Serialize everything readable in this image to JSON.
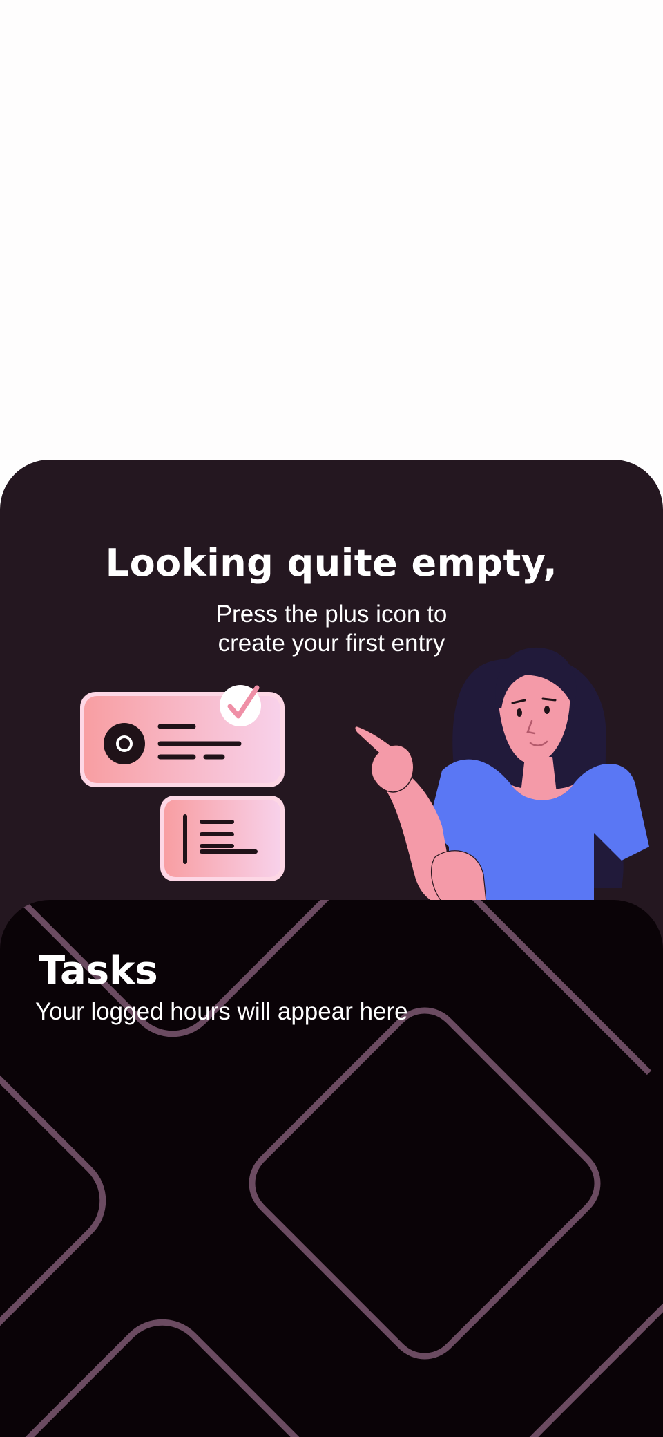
{
  "empty_state": {
    "title": "Looking quite empty,",
    "subtitle": "Press the plus icon to\ncreate your first entry",
    "illustration": {
      "icons": [
        "entry-card-icon",
        "check-badge-icon",
        "list-card-icon",
        "pointing-woman-illustration"
      ],
      "colors": {
        "card_gradient_start": "#f79ca0",
        "card_gradient_end": "#f8cfe8",
        "shirt": "#5a77f4",
        "hair": "#211a3a",
        "skin": "#f49aa8"
      }
    }
  },
  "tasks": {
    "title": "Tasks",
    "subtitle": "Your logged hours will appear here",
    "pattern_color": "#6b4b61"
  },
  "colors": {
    "page_background": "#fefefe",
    "empty_card_background": "#241720",
    "tasks_card_background": "#0a0307",
    "text": "#ffffff"
  }
}
